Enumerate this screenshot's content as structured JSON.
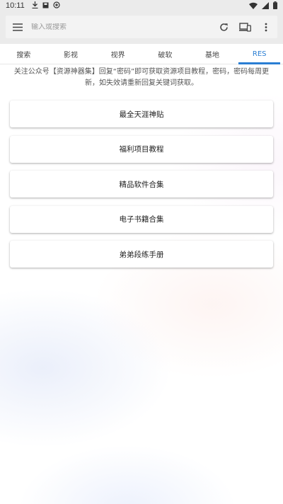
{
  "status_bar": {
    "time": "10:11",
    "icons_left": [
      "download-icon",
      "save-icon",
      "app-icon"
    ],
    "icons_right": [
      "wifi-icon",
      "signal-icon",
      "battery-icon"
    ]
  },
  "toolbar": {
    "search_placeholder": "输入或搜索",
    "icons": [
      "menu-icon",
      "refresh-icon",
      "devices-icon",
      "more-vert-icon"
    ]
  },
  "tabs": [
    {
      "label": "搜索",
      "active": false
    },
    {
      "label": "影视",
      "active": false
    },
    {
      "label": "视界",
      "active": false
    },
    {
      "label": "破软",
      "active": false
    },
    {
      "label": "基地",
      "active": false
    },
    {
      "label": "RES",
      "active": true
    }
  ],
  "notice": "关注公众号【资源神器集】回复“密码”即可获取资源项目教程，密码，密码每周更新，如失效请重新回复关键词获取。",
  "cards": [
    {
      "label": "最全天涯神贴"
    },
    {
      "label": "福利项目教程"
    },
    {
      "label": "精品软件合集"
    },
    {
      "label": "电子书籍合集"
    },
    {
      "label": "弟弟段练手册"
    }
  ],
  "colors": {
    "accent": "#2a7ed3",
    "toolbar_bg": "#ebebeb",
    "card_bg": "#ffffff"
  }
}
